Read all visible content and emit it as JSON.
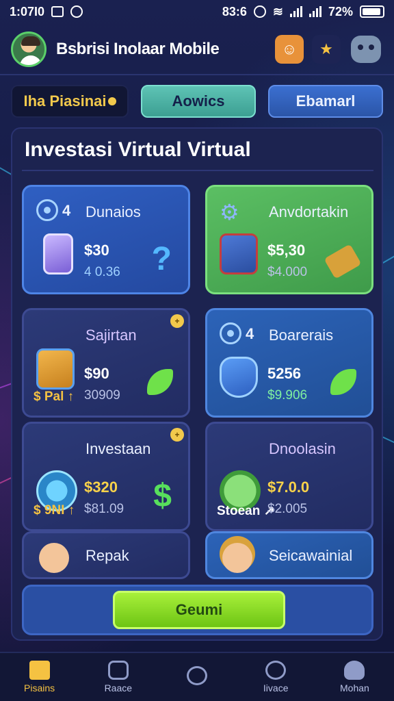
{
  "status_bar": {
    "time": "1:07I0",
    "right_time": "83:6",
    "battery": "72%"
  },
  "header": {
    "title": "Bsbrisi Inolaar Mobile",
    "icons": [
      "profile-icon",
      "star-icon",
      "bot-icon"
    ]
  },
  "tabs": [
    {
      "label": "Iha Piasinai"
    },
    {
      "label": "Aowics"
    },
    {
      "label": "Ebamarl"
    }
  ],
  "panel": {
    "title": "Investasi Virtual Virtual"
  },
  "cards": [
    {
      "title": "Dunaios",
      "prefix": "4",
      "value": "$30",
      "sub": "4 0.36",
      "icon": "target-icon",
      "art": "phone-icon",
      "glyph": "?"
    },
    {
      "title": "Anvdortakin",
      "value": "$5,30",
      "sub": "$4.000",
      "icon": "gear-icon",
      "art": "documents-icon",
      "glyph": "hammer-icon"
    },
    {
      "title": "Sajirtan",
      "value": "$90",
      "sub": "30909",
      "prefix": "$ Pal ↑",
      "icon": "folder-icon",
      "glyph": "leaf-icon"
    },
    {
      "title": "Boarerais",
      "prefix": "4",
      "value": "5256",
      "sub": "$9.906",
      "icon": "target-icon",
      "art": "shield-icon",
      "glyph": "leaf-icon"
    },
    {
      "title": "Investaan",
      "value": "$320",
      "sub": "$81.09",
      "prefix": "$ 9NI ↑",
      "icon": "coin-icon",
      "glyph": "$"
    },
    {
      "title": "Dnoolasin",
      "value": "$7.0.0",
      "sub": "$2.005",
      "prefix": "Stoean ↗",
      "icon": "wrench-icon"
    },
    {
      "title": "Repak",
      "icon": "person-icon"
    },
    {
      "title": "Seicawainial",
      "icon": "woman-icon"
    }
  ],
  "action": {
    "label": "Geumi"
  },
  "bottom_nav": [
    {
      "label": "Pisains",
      "icon": "home-icon"
    },
    {
      "label": "Raace",
      "icon": "chat-icon"
    },
    {
      "label": "",
      "icon": "wallet-icon"
    },
    {
      "label": "Iivace",
      "icon": "face-icon"
    },
    {
      "label": "Mohan",
      "icon": "user-icon"
    }
  ],
  "colors": {
    "background": "#141a3d",
    "accent_gold": "#f5c242",
    "accent_green": "#6dc414",
    "accent_blue": "#2f5fc2"
  }
}
